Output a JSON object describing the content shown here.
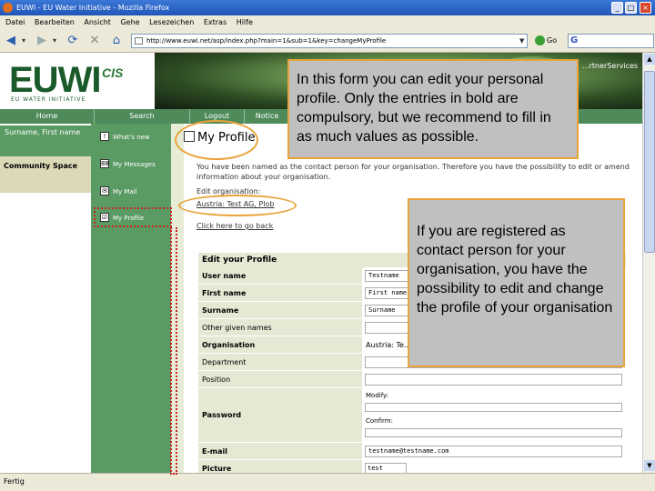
{
  "window": {
    "title": "EUWI - EU Water Initiative - Mozilla Firefox",
    "min": "_",
    "max": "□",
    "close": "×"
  },
  "menubar": [
    "Datei",
    "Bearbeiten",
    "Ansicht",
    "Gehe",
    "Lesezeichen",
    "Extras",
    "Hilfe"
  ],
  "nav": {
    "back": "◀",
    "back_drop": "▾",
    "forward": "▶",
    "forward_drop": "▾",
    "reload": "⟳",
    "stop": "✕",
    "home": "⌂",
    "url": "http://www.euwi.net/asp/index.php?main=1&sub=1&key=changeMyProfile",
    "url_drop": "▼",
    "go": "Go",
    "search_g": "G"
  },
  "banner": {
    "logo": "EUWI",
    "logo_cis": "CIS",
    "logo_sub": "EU WATER INITIATIVE",
    "partner_services": "...rtnerServices"
  },
  "topnav": [
    "Home",
    "Search",
    "Logout",
    "Notice"
  ],
  "leftcol": {
    "user": "Surname, First name",
    "community": "Community Space"
  },
  "menu": [
    {
      "icon": "!",
      "label": "What's new"
    },
    {
      "icon": "88",
      "label": "My Messages"
    },
    {
      "icon": "✉",
      "label": "My Mail"
    },
    {
      "icon": "☑",
      "label": "My Profile"
    }
  ],
  "main": {
    "title": "My Profile",
    "intro": "You have been named as the contact person for your organisation. Therefore you have the possibility to edit or amend information about your organisation.",
    "edit_org": "Edit organisation:",
    "org_link": "Austria: Test AG, Plob",
    "back_link": "Click here to go back"
  },
  "form": {
    "heading": "Edit your Profile",
    "rows": [
      {
        "label": "User name",
        "value": "Testname",
        "bold": true
      },
      {
        "label": "First name",
        "value": "First name",
        "bold": true
      },
      {
        "label": "Surname",
        "value": "Surname",
        "bold": true
      },
      {
        "label": "Other given names",
        "value": "",
        "bold": false
      },
      {
        "label": "Organisation",
        "value": "Austria: Te...",
        "bold": true
      },
      {
        "label": "Department",
        "value": "",
        "bold": false
      },
      {
        "label": "Position",
        "value": "",
        "bold": false
      }
    ],
    "password": {
      "label": "Password",
      "modify": "Modify:",
      "confirm": "Confirm:"
    },
    "email": {
      "label": "E-mail",
      "value": "testname@testname.com"
    },
    "partial_label": "Picture",
    "partial_value": "test"
  },
  "status": "Fertig",
  "callouts": {
    "c1": "In this form you can edit your personal profile. Only the entries in bold are compulsory, but we recommend to fill in as much values as possible.",
    "c2": "If you are registered as contact person for your organisation, you have the possibility to edit and change the profile of your organisation"
  },
  "colors": {
    "green": "#5a9a63",
    "dark_green": "#1a5a2a",
    "callout_bg": "#c0c0c0",
    "callout_border": "#e8a33a",
    "highlight_red": "#d02020"
  }
}
